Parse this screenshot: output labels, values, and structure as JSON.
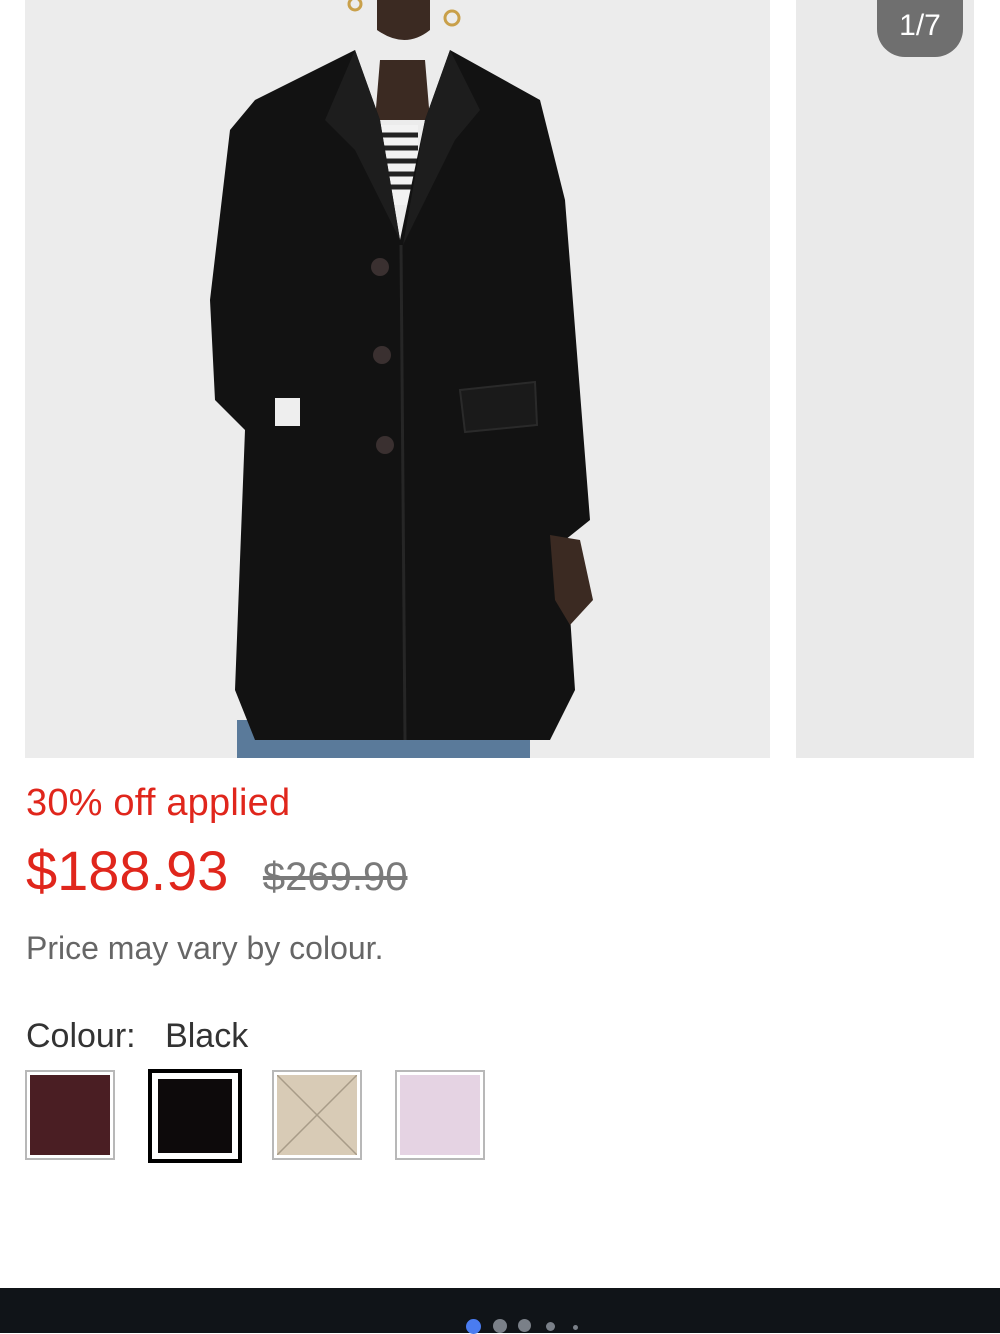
{
  "gallery": {
    "counter": "1/7",
    "main_image": "coat-model-photo",
    "next_image": "product-photo-preview"
  },
  "product": {
    "discount_text": "30% off applied",
    "price_now": "$188.93",
    "price_was": "$269.90",
    "price_note": "Price may vary by colour."
  },
  "colour": {
    "label": "Colour:",
    "selected": "Black",
    "swatches": [
      {
        "name": "burgundy",
        "color": "#4a1e23"
      },
      {
        "name": "black",
        "color": "#0d0a0b",
        "selected": true
      },
      {
        "name": "camel",
        "color": "#d8cbb6"
      },
      {
        "name": "lilac",
        "color": "#e5d3e3"
      }
    ]
  },
  "pager": {
    "active_color": "#4a7cf0",
    "inactive_color": "#7a8088"
  },
  "colors": {
    "sale_red": "#e0261c",
    "footer_bg": "#101418"
  }
}
